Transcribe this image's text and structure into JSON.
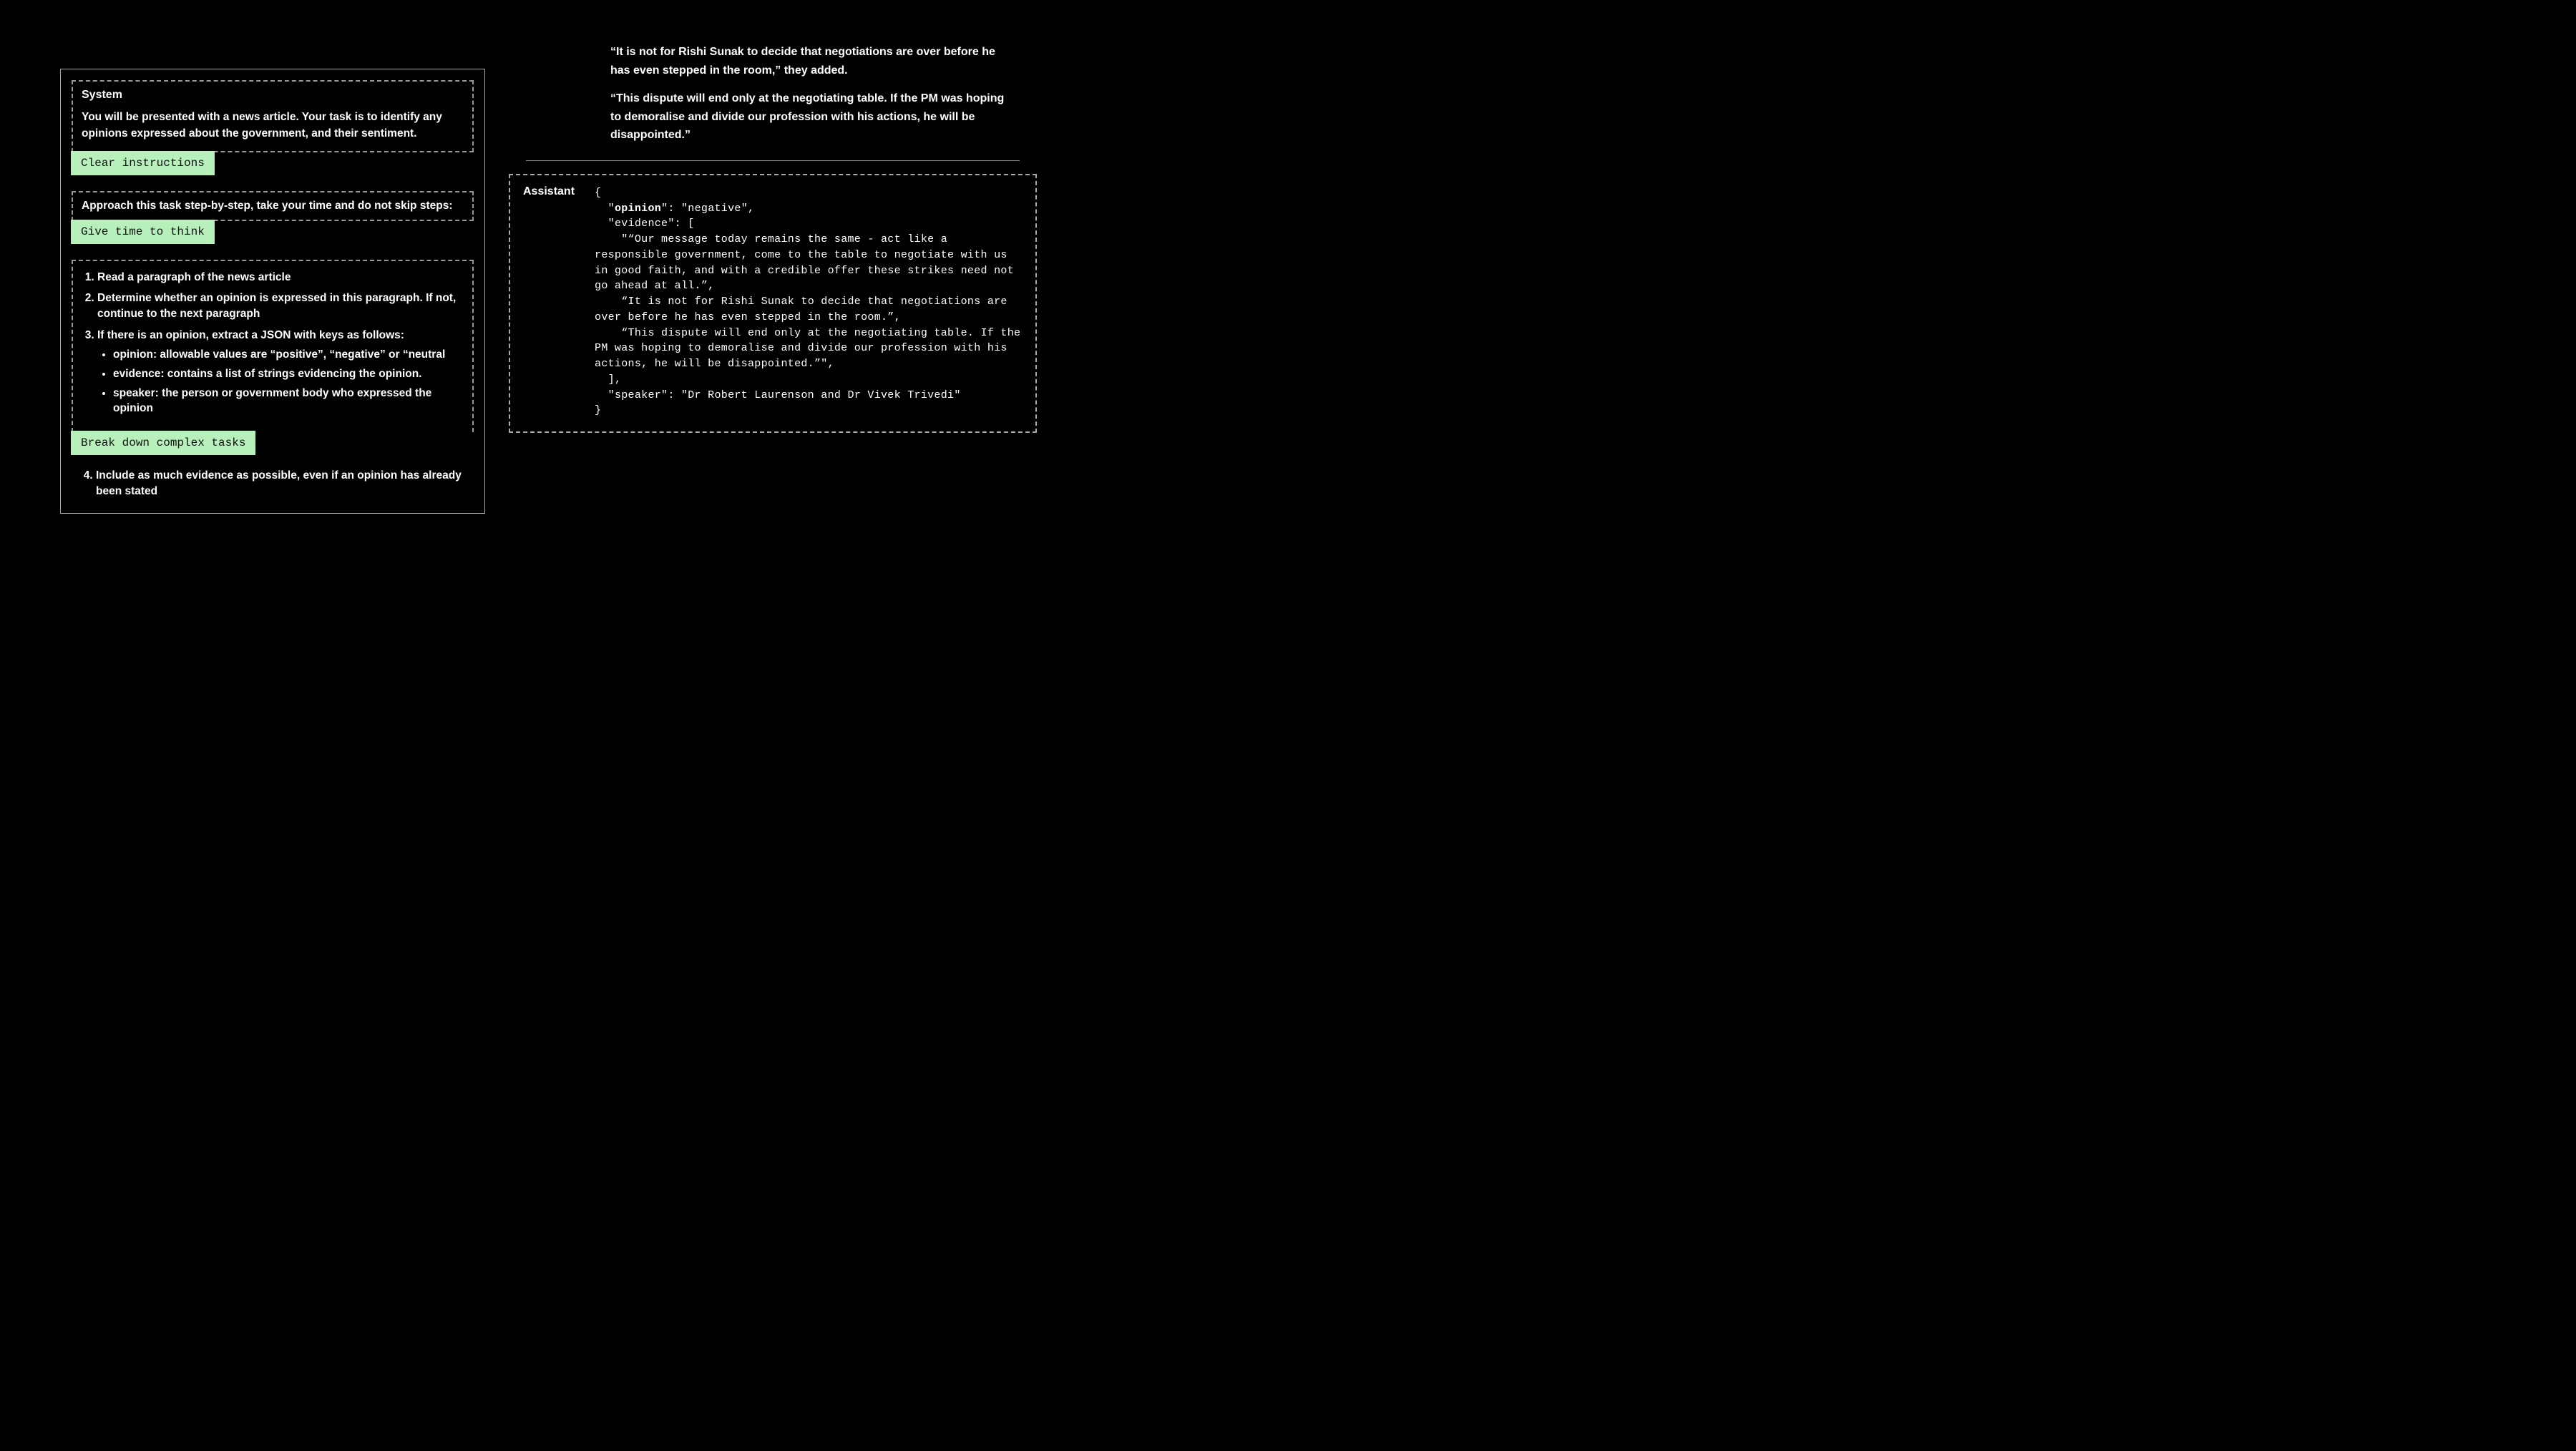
{
  "left": {
    "system_header": "System",
    "system_text": "You will be presented with a news article. Your task is to identify any opinions expressed about the government, and their sentiment.",
    "label_clear": "Clear instructions",
    "approach_text": "Approach this task step-by-step, take your time and do not skip steps:",
    "label_think": "Give time to think",
    "step1": "Read a paragraph of the news article",
    "step2": "Determine whether an opinion is expressed in this paragraph. If not, continue to the next paragraph",
    "step3": "If there is an opinion, extract a JSON with keys as follows:",
    "step3a": "opinion: allowable values are “positive”, “negative” or “neutral",
    "step3b": "evidence: contains a list of strings evidencing the opinion.",
    "step3c": "speaker: the person or government body who expressed the opinion",
    "label_breakdown": "Break down complex tasks",
    "step4": "Include as much evidence as possible, even if an opinion has already been stated"
  },
  "right": {
    "quote1": "“It is not for Rishi Sunak to decide that negotiations are over before he has even stepped in the room,” they added.",
    "quote2": "“This dispute will end only at the negotiating table. If the PM was hoping to demoralise and divide our profession with his actions, he will be disappointed.”",
    "assistant_label": "Assistant",
    "code": "{\n  \"opinion\": \"negative\",\n  \"evidence\": [\n    \"“Our message today remains the same - act like a responsible government, come to the table to negotiate with us in good faith, and with a credible offer these strikes need not go ahead at all.”,\n    “It is not for Rishi Sunak to decide that negotiations are over before he has even stepped in the room.”,\n    “This dispute will end only at the negotiating table. If the PM was hoping to demoralise and divide our profession with his actions, he will be disappointed.”\",\n  ],\n  \"speaker\": \"Dr Robert Laurenson and Dr Vivek Trivedi\"\n}"
  }
}
